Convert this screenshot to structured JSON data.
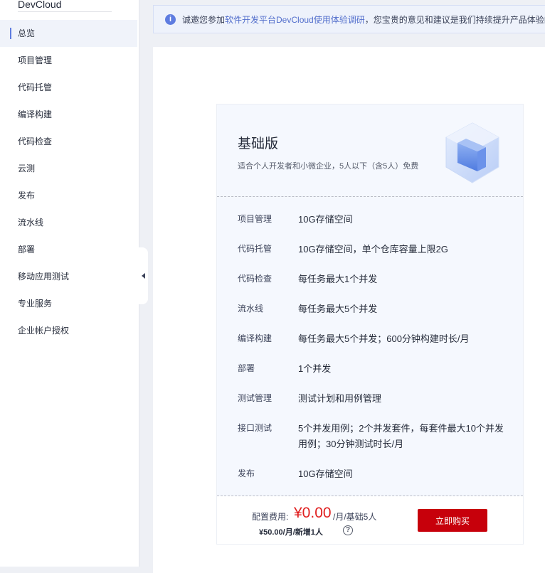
{
  "sidebar": {
    "brand": "DevCloud",
    "items": [
      {
        "label": "总览"
      },
      {
        "label": "项目管理"
      },
      {
        "label": "代码托管"
      },
      {
        "label": "编译构建"
      },
      {
        "label": "代码检查"
      },
      {
        "label": "云测"
      },
      {
        "label": "发布"
      },
      {
        "label": "流水线"
      },
      {
        "label": "部署"
      },
      {
        "label": "移动应用测试"
      },
      {
        "label": "专业服务"
      },
      {
        "label": "企业帐户授权"
      }
    ]
  },
  "notice": {
    "prefix": "诚邀您参加",
    "link": "软件开发平台DevCloud使用体验调研",
    "suffix": "，您宝贵的意见和建议是我们持续提升产品体验的动力"
  },
  "plan": {
    "name": "基础版",
    "description": "适合个人开发者和小微企业，5人以下（含5人）免费",
    "features": [
      {
        "name": "项目管理",
        "value": "10G存储空间"
      },
      {
        "name": "代码托管",
        "value": "10G存储空间，单个仓库容量上限2G"
      },
      {
        "name": "代码检查",
        "value": "每任务最大1个并发"
      },
      {
        "name": "流水线",
        "value": "每任务最大5个并发"
      },
      {
        "name": "编译构建",
        "value": "每任务最大5个并发；600分钟构建时长/月"
      },
      {
        "name": "部署",
        "value": "1个并发"
      },
      {
        "name": "测试管理",
        "value": "测试计划和用例管理"
      },
      {
        "name": "接口测试",
        "value": "5个并发用例；2个并发套件，每套件最大10个并发用例；30分钟测试时长/月"
      },
      {
        "name": "发布",
        "value": "10G存储空间"
      }
    ],
    "price_label": "配置费用:",
    "price_amount": "¥0.00",
    "price_unit": "/月/基础5人",
    "extra_price": "¥50.00/月/新增1人",
    "help": "?",
    "buy_label": "立即购买"
  },
  "colors": {
    "accent": "#5e7ce0",
    "buy": "#c7000b",
    "price": "#e02020"
  }
}
